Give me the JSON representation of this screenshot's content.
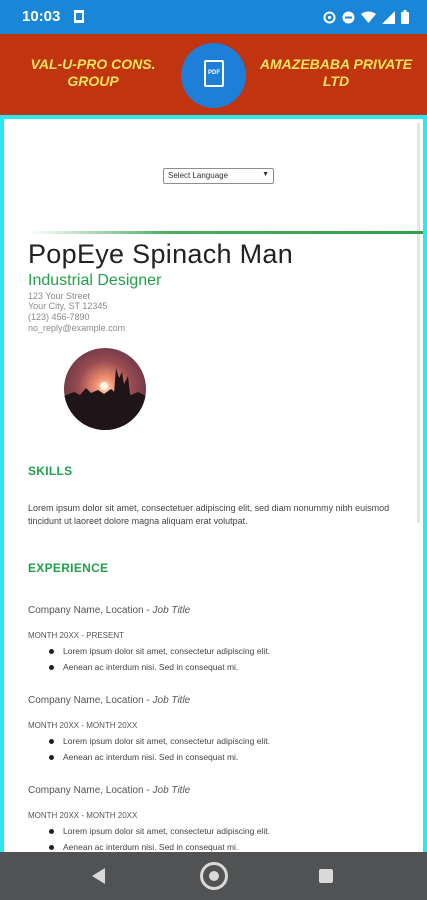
{
  "status_bar": {
    "time": "10:03"
  },
  "header": {
    "left_title": "VAL-U-PRO CONS. GROUP",
    "right_title": "AMAZEBABA PRIVATE LTD",
    "logo_text": "PDF"
  },
  "language_select": {
    "value": "Select Language"
  },
  "resume": {
    "name": "PopEye Spinach Man",
    "role": "Industrial Designer",
    "contact": [
      "123 Your Street",
      "Your City, ST 12345",
      "(123) 456-7890",
      "no_reply@example.com"
    ],
    "skills_heading": "SKILLS",
    "skills_text": "Lorem ipsum dolor sit amet, consectetuer adipiscing elit, sed diam nonummy nibh euismod tincidunt ut laoreet dolore magna aliquam erat volutpat.",
    "experience_heading": "EXPERIENCE",
    "jobs": [
      {
        "company": "Company Name,  Location - ",
        "title": "Job Title",
        "dates": "MONTH 20XX - PRESENT",
        "bullets": [
          "Lorem ipsum dolor sit amet, consectetur adipiscing elit.",
          "Aenean ac interdum nisi. Sed in consequat mi."
        ]
      },
      {
        "company": "Company Name, Location - ",
        "title": "Job Title",
        "dates": "MONTH 20XX - MONTH 20XX",
        "bullets": [
          "Lorem ipsum dolor sit amet, consectetur adipiscing elit.",
          "Aenean ac interdum nisi. Sed in consequat mi."
        ]
      },
      {
        "company": "Company Name, Location - ",
        "title": "Job Title",
        "dates": "MONTH 20XX - MONTH 20XX",
        "bullets": [
          "Lorem ipsum dolor sit amet, consectetur adipiscing elit.",
          "Aenean ac interdum nisi. Sed in consequat mi."
        ]
      }
    ]
  },
  "colors": {
    "status_bar": "#1a86d8",
    "header": "#c0350f",
    "header_text": "#f7e35a",
    "accent_green": "#22a14a",
    "frame_border": "#2ee6f0",
    "nav_bar": "#515253"
  },
  "icons": [
    "note-icon",
    "sync-icon",
    "dnd-icon",
    "wifi-icon",
    "signal-icon",
    "battery-icon",
    "pdf-icon",
    "back-icon",
    "home-icon",
    "recents-icon"
  ]
}
